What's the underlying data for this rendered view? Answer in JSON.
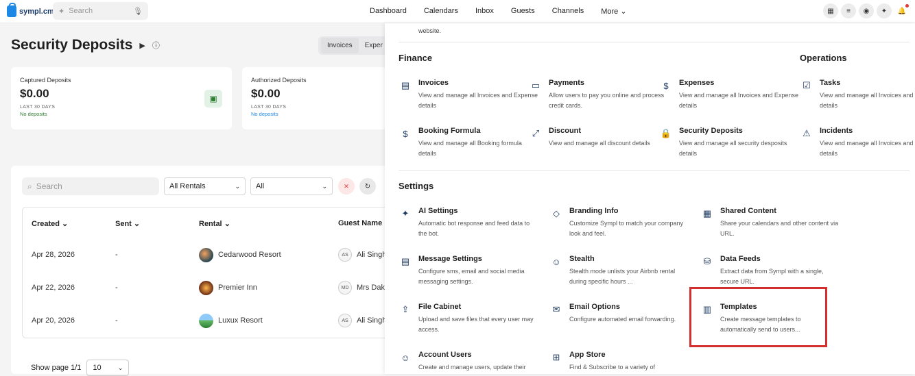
{
  "app": {
    "logo_text": "sympl.cm"
  },
  "top_search": {
    "placeholder": "Search"
  },
  "nav": [
    "Dashboard",
    "Calendars",
    "Inbox",
    "Guests",
    "Channels",
    "More"
  ],
  "page": {
    "title": "Security Deposits"
  },
  "tabs": [
    "Invoices",
    "Exper"
  ],
  "cards": [
    {
      "label": "Captured Deposits",
      "amount": "$0.00",
      "period": "LAST 30 DAYS",
      "note": "No deposits",
      "note_color": "#2e7d32"
    },
    {
      "label": "Authorized Deposits",
      "amount": "$0.00",
      "period": "LAST 30 DAYS",
      "note": "No deposits",
      "note_color": "#1e88e5"
    }
  ],
  "filters": {
    "search_placeholder": "Search",
    "rentals": "All Rentals",
    "status": "All"
  },
  "table": {
    "headers": [
      "Created",
      "Sent",
      "Rental",
      "Guest Name"
    ],
    "rows": [
      {
        "created": "Apr 28, 2026",
        "sent": "-",
        "rental": "Cedarwood Resort",
        "initials": "AS",
        "guest": "Ali Singh"
      },
      {
        "created": "Apr 22, 2026",
        "sent": "-",
        "rental": "Premier Inn",
        "initials": "MD",
        "guest": "Mrs Daks"
      },
      {
        "created": "Apr 20, 2026",
        "sent": "-",
        "rental": "Luxux Resort",
        "initials": "AS",
        "guest": "Ali Singh"
      }
    ]
  },
  "pager": {
    "label": "Show page 1/1",
    "per_page": "10"
  },
  "menu": {
    "top_fragment": "website.",
    "finance_title": "Finance",
    "operations_title": "Operations",
    "settings_title": "Settings",
    "finance": [
      {
        "name": "Invoices",
        "desc": "View and manage all Invoices and Expense details"
      },
      {
        "name": "Payments",
        "desc": "Allow users to pay you online and process credit cards."
      },
      {
        "name": "Expenses",
        "desc": "View and manage all Invoices and Expense details"
      },
      {
        "name": "Booking Formula",
        "desc": "View and manage all Booking formula details"
      },
      {
        "name": "Discount",
        "desc": "View and manage all discount details"
      },
      {
        "name": "Security Deposits",
        "desc": "View and manage all security desposits details"
      }
    ],
    "operations": [
      {
        "name": "Tasks",
        "desc": "View and manage all Invoices and Expense details"
      },
      {
        "name": "Incidents",
        "desc": "View and manage all Invoices and Expense details"
      }
    ],
    "settings": [
      {
        "name": "AI Settings",
        "desc": "Automatic bot response and feed data to the bot."
      },
      {
        "name": "Branding Info",
        "desc": "Customize Sympl to match your company look and feel."
      },
      {
        "name": "Shared Content",
        "desc": "Share your calendars and other content via URL."
      },
      {
        "name": "Message Settings",
        "desc": "Configure sms, email and social media messaging settings."
      },
      {
        "name": "Stealth",
        "desc": "Stealth mode unlists your Airbnb rental during specific hours ..."
      },
      {
        "name": "Data Feeds",
        "desc": "Extract data from Sympl with a single, secure URL."
      },
      {
        "name": "File Cabinet",
        "desc": "Upload and save files that every user may access."
      },
      {
        "name": "Email Options",
        "desc": "Configure automated email forwarding."
      },
      {
        "name": "Templates",
        "desc": "Create message templates to automatically send to users..."
      },
      {
        "name": "Account Users",
        "desc": "Create and manage users, update their"
      },
      {
        "name": "App Store",
        "desc": "Find & Subscribe to a variety of"
      }
    ]
  }
}
